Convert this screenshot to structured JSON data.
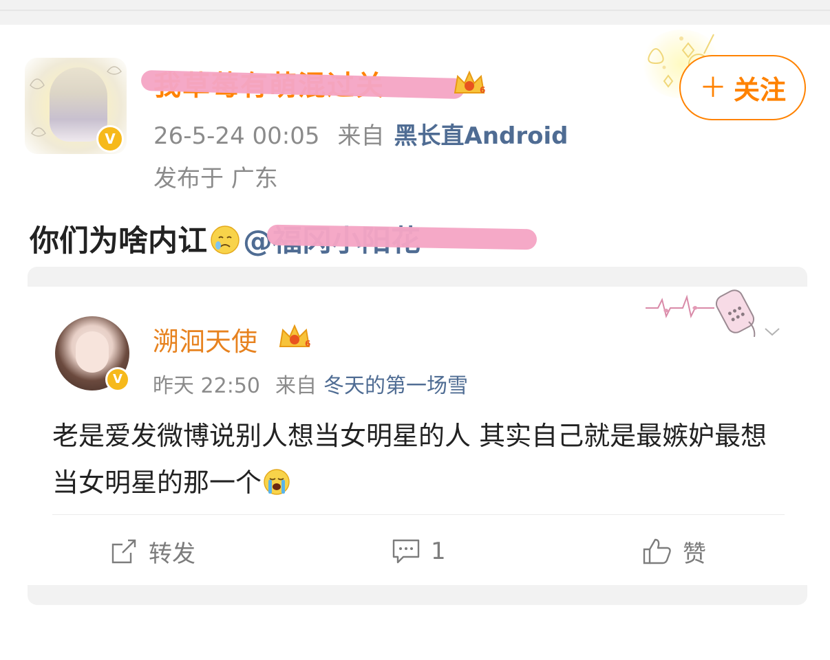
{
  "author": {
    "name": "我草莓有萌混过关",
    "verified_badge": "V",
    "level_badge": "6",
    "timestamp": "26-5-24 00:05",
    "from_label": "来自",
    "source": "黑长直Android",
    "location": "发布于 广东"
  },
  "follow_button": {
    "plus": "＋",
    "label": "关注"
  },
  "post": {
    "text": "你们为啥内讧",
    "mention": "@福冈小阳花",
    "emoji": "crying-yellow-face"
  },
  "repost": {
    "user": "溯洄天使",
    "verified_badge": "V",
    "level_badge": "6",
    "time": "昨天 22:50",
    "from_label": "来自",
    "source": "冬天的第一场雪",
    "text": "老是爱发微博说别人想当女明星的人 其实自己就是最嫉妒最想当女明星的那一个",
    "emoji": "loudly-crying-face"
  },
  "actions": {
    "repost_label": "转发",
    "comment_count": "1",
    "like_label": "赞"
  },
  "colors": {
    "accent": "#ff8200",
    "link": "#4f6c93",
    "meta": "#8b8b8b",
    "redaction": "#f5a6c5",
    "vip": "#f6b91b"
  }
}
